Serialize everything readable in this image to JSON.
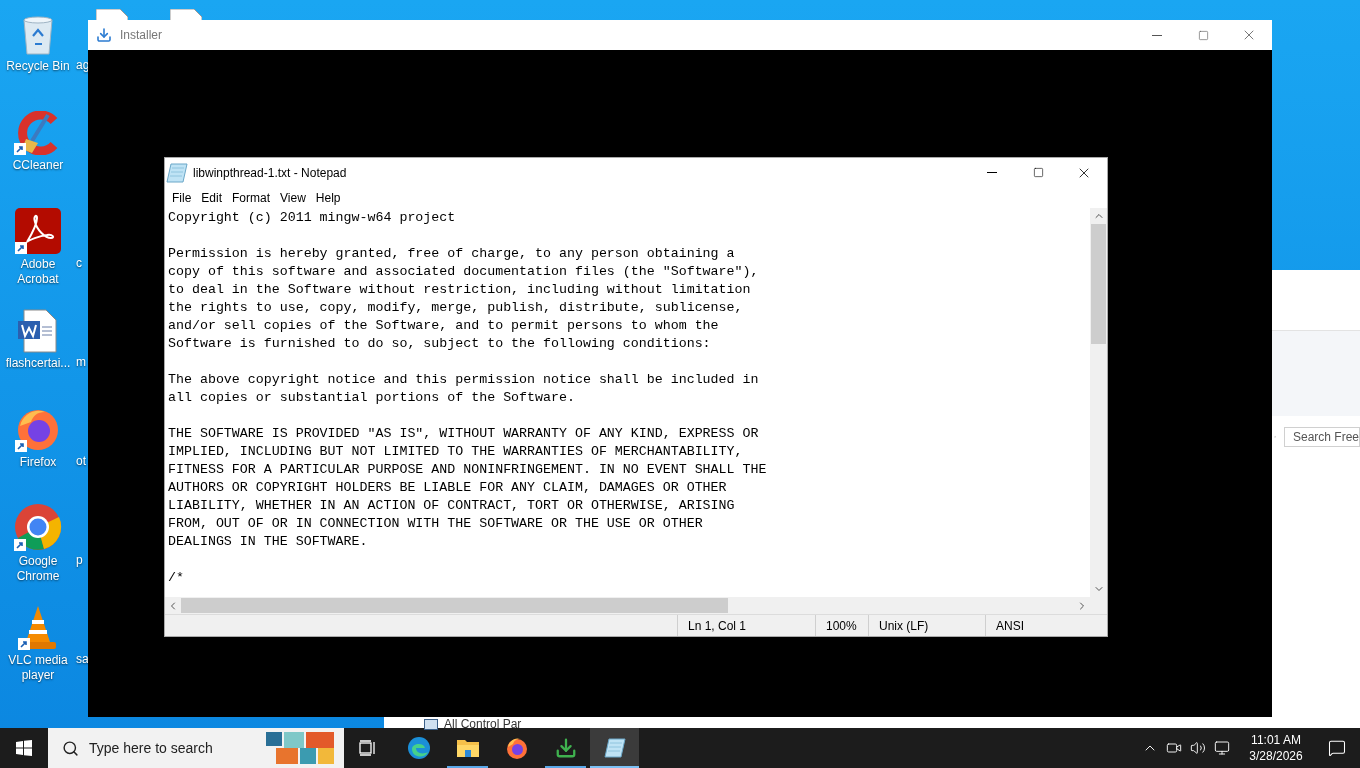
{
  "desktop": {
    "icons": [
      {
        "label": "Recycle Bin",
        "kind": "recycle",
        "shortcut": false
      },
      {
        "label": "CCleaner",
        "kind": "ccleaner",
        "shortcut": true
      },
      {
        "label": "Adobe Acrobat",
        "kind": "acrobat",
        "shortcut": true
      },
      {
        "label": "flashcertai...",
        "kind": "word",
        "shortcut": false
      },
      {
        "label": "Firefox",
        "kind": "firefox",
        "shortcut": true
      },
      {
        "label": "Google Chrome",
        "kind": "chrome",
        "shortcut": true
      },
      {
        "label": "VLC media player",
        "kind": "vlc",
        "shortcut": true
      }
    ],
    "partial_labels": [
      "ag",
      "c",
      "m",
      "ot",
      "p",
      "sa"
    ]
  },
  "background_window": {
    "search": {
      "placeholder": "Search Free"
    }
  },
  "installer": {
    "title": "Installer"
  },
  "notepad": {
    "title": "libwinpthread-1.txt - Notepad",
    "menu": [
      "File",
      "Edit",
      "Format",
      "View",
      "Help"
    ],
    "paragraphs": [
      [
        "Copyright (c) 2011 mingw-w64 project"
      ],
      [
        "Permission is hereby granted, free of charge, to any person obtaining a",
        "copy of this software and associated documentation files (the \"Software\"),",
        "to deal in the Software without restriction, including without limitation",
        "the rights to use, copy, modify, merge, publish, distribute, sublicense,",
        "and/or sell copies of the Software, and to permit persons to whom the",
        "Software is furnished to do so, subject to the following conditions:"
      ],
      [
        "The above copyright notice and this permission notice shall be included in",
        "all copies or substantial portions of the Software."
      ],
      [
        "THE SOFTWARE IS PROVIDED \"AS IS\", WITHOUT WARRANTY OF ANY KIND, EXPRESS OR",
        "IMPLIED, INCLUDING BUT NOT LIMITED TO THE WARRANTIES OF MERCHANTABILITY,",
        "FITNESS FOR A PARTICULAR PURPOSE AND NONINFRINGEMENT. IN NO EVENT SHALL THE",
        "AUTHORS OR COPYRIGHT HOLDERS BE LIABLE FOR ANY CLAIM, DAMAGES OR OTHER",
        "LIABILITY, WHETHER IN AN ACTION OF CONTRACT, TORT OR OTHERWISE, ARISING",
        "FROM, OUT OF OR IN CONNECTION WITH THE SOFTWARE OR THE USE OR OTHER",
        "DEALINGS IN THE SOFTWARE."
      ]
    ],
    "cut_line": "/*",
    "status": [
      "Ln 1, Col 1",
      "100%",
      "Unix (LF)",
      "ANSI"
    ]
  },
  "taskbar": {
    "search": {
      "placeholder": "Type here to search"
    },
    "apps": [
      {
        "kind": "edge",
        "open": false,
        "selected": false
      },
      {
        "kind": "explorer",
        "open": true,
        "selected": false
      },
      {
        "kind": "firefox",
        "open": false,
        "selected": false
      },
      {
        "kind": "installer",
        "open": true,
        "selected": false
      },
      {
        "kind": "notepad",
        "open": true,
        "selected": true
      }
    ],
    "preview_text": "All Control Par",
    "clock": {
      "time": "11:01 AM",
      "date": "3/28/2026"
    }
  }
}
